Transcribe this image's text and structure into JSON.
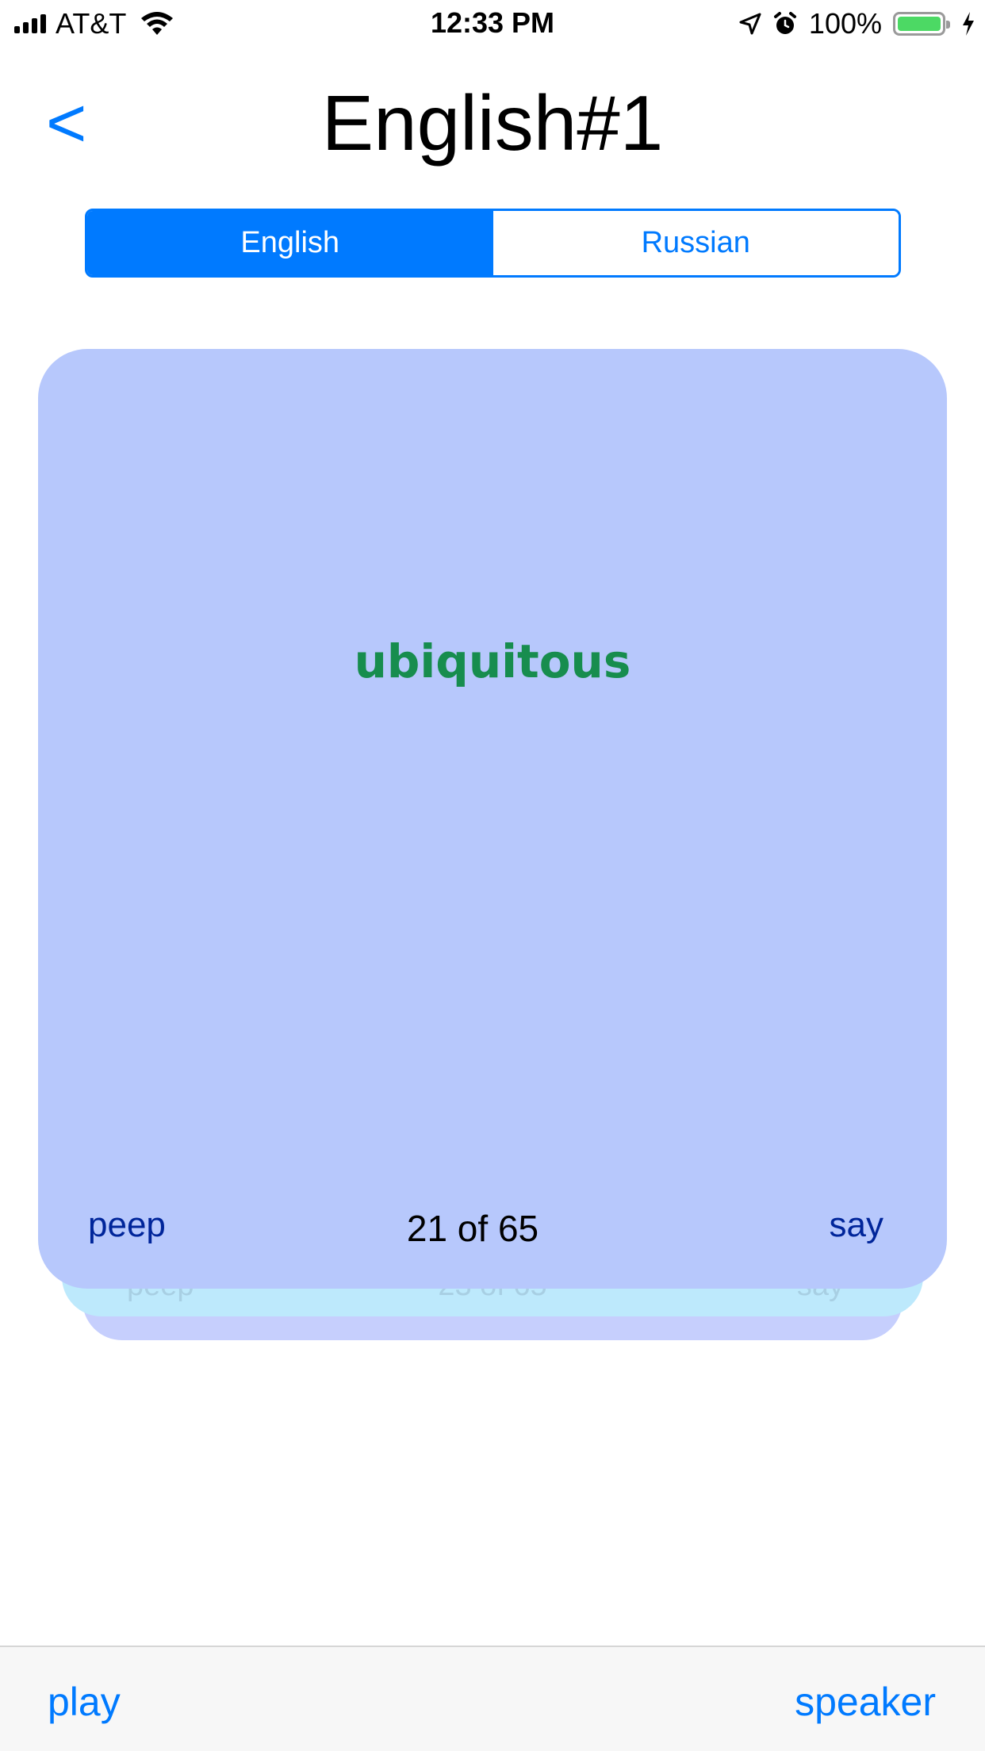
{
  "status_bar": {
    "carrier": "AT&T",
    "time": "12:33 PM",
    "battery_percent": "100%",
    "battery_level": 1.0,
    "battery_color": "#4cd964",
    "icons": [
      "signal-icon",
      "wifi-icon",
      "location-icon",
      "alarm-icon",
      "battery-icon",
      "charging-icon"
    ]
  },
  "nav": {
    "back_label": "<",
    "title": "English#1"
  },
  "segmented": {
    "options": [
      "English",
      "Russian"
    ],
    "selected": "English"
  },
  "card": {
    "word": "ubiquitous",
    "left_action": "peep",
    "counter": "21 of 65",
    "right_action": "say"
  },
  "back_card": {
    "left_action": "peep",
    "counter": "23 of 65",
    "right_action": "say"
  },
  "toolbar": {
    "play_label": "play",
    "speaker_label": "speaker"
  },
  "colors": {
    "accent": "#007aff",
    "card_front": "#b7c8fc",
    "word": "#178d4e"
  }
}
